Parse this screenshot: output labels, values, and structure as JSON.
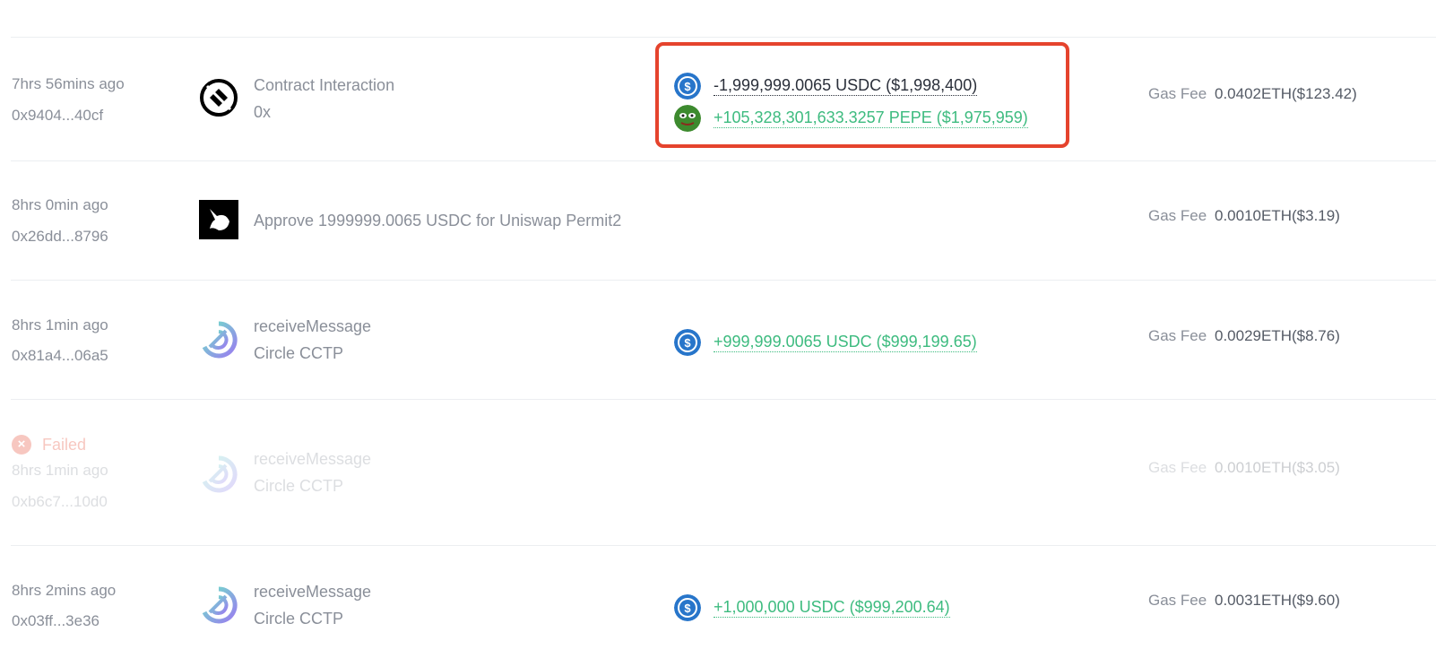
{
  "colors": {
    "accent_positive": "#3dbb7f",
    "failed": "#e5432d",
    "highlight": "#e5432d",
    "usdc": "#2775ca",
    "pepe": "#3d8a2e"
  },
  "gas_label": "Gas Fee",
  "rows": [
    {
      "time": "7hrs 56mins ago",
      "hash": "0x9404...40cf",
      "icon": "0x-protocol-icon",
      "title": "Contract Interaction",
      "subtitle": "0x",
      "amounts": [
        {
          "text": "-1,999,999.0065 USDC ($1,998,400)",
          "token": "usdc-icon",
          "dir": "out"
        },
        {
          "text": "+105,328,301,633.3257 PEPE ($1,975,959)",
          "token": "pepe-icon",
          "dir": "in"
        }
      ],
      "gas": "0.0402ETH($123.42)"
    },
    {
      "time": "8hrs 0min ago",
      "hash": "0x26dd...8796",
      "icon": "uniswap-icon",
      "title": "Approve 1999999.0065 USDC for Uniswap Permit2",
      "gas": "0.0010ETH($3.19)"
    },
    {
      "time": "8hrs 1min ago",
      "hash": "0x81a4...06a5",
      "icon": "circle-cctp-icon",
      "title": "receiveMessage",
      "subtitle": "Circle CCTP",
      "amounts": [
        {
          "text": "+999,999.0065 USDC ($999,199.65)",
          "token": "usdc-icon",
          "dir": "in"
        }
      ],
      "gas": "0.0029ETH($8.76)"
    },
    {
      "status": "Failed",
      "time": "8hrs 1min ago",
      "hash": "0xb6c7...10d0",
      "icon": "circle-cctp-icon",
      "title": "receiveMessage",
      "subtitle": "Circle CCTP",
      "gas": "0.0010ETH($3.05)"
    },
    {
      "time": "8hrs 2mins ago",
      "hash": "0x03ff...3e36",
      "icon": "circle-cctp-icon",
      "title": "receiveMessage",
      "subtitle": "Circle CCTP",
      "amounts": [
        {
          "text": "+1,000,000 USDC ($999,200.64)",
          "token": "usdc-icon",
          "dir": "in"
        }
      ],
      "gas": "0.0031ETH($9.60)"
    }
  ]
}
